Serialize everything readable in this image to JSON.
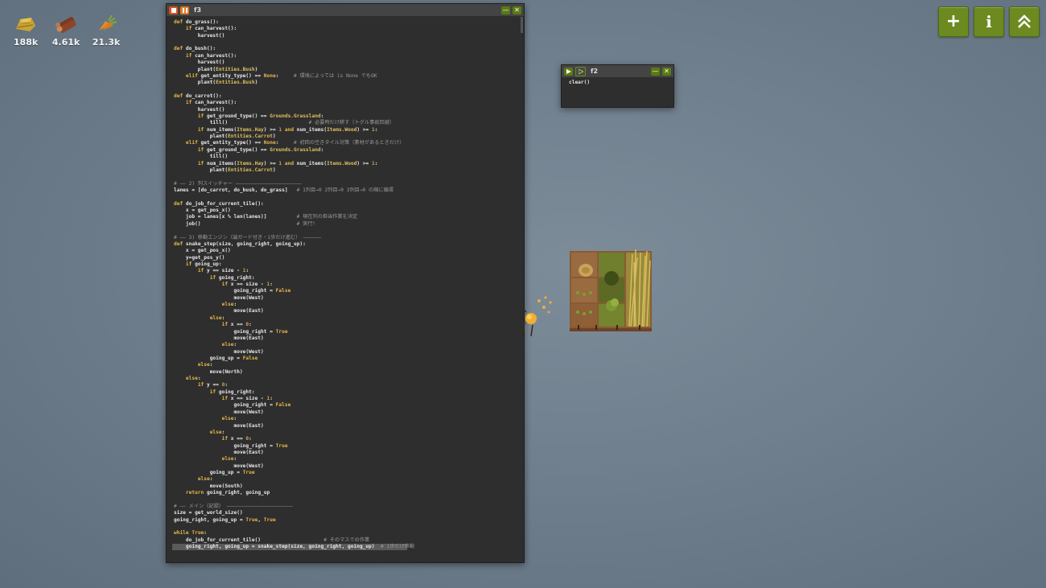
{
  "resources": [
    {
      "name": "hay-icon",
      "count": "188k"
    },
    {
      "name": "wood-icon",
      "count": "4.61k"
    },
    {
      "name": "carrot-icon",
      "count": "21.3k"
    }
  ],
  "top_right_buttons": [
    {
      "name": "add-button",
      "label": "+"
    },
    {
      "name": "info-button",
      "label": "i"
    },
    {
      "name": "upgrade-button",
      "label": "⌃"
    }
  ],
  "editor": {
    "title": "f3",
    "lines": [
      "def do_grass():",
      "    if can_harvest():",
      "        harvest()",
      "",
      "def do_bush():",
      "    if can_harvest():",
      "        harvest()",
      "        plant(Entities.Bush)",
      "    elif get_entity_type() == None:     # 環境によっては is None でもOK",
      "        plant(Entities.Bush)",
      "",
      "def do_carrot():",
      "    if can_harvest():",
      "        harvest()",
      "        if get_ground_type() == Grounds.Grassland:",
      "            till()                           # 必要時だけ耕す（トグル事故回避）",
      "        if num_items(Items.Hay) >= 1 and num_items(Items.Wood) >= 1:",
      "            plant(Entities.Carrot)",
      "    elif get_entity_type() == None:     # 初回の空きタイル対策（素材があるときだけ）",
      "        if get_ground_type() == Grounds.Grassland:",
      "            till()",
      "        if num_items(Items.Hay) >= 1 and num_items(Items.Wood) >= 1:",
      "            plant(Entities.Carrot)",
      "",
      "# —— 2) 列スイッチャー ——————————————————————",
      "lanes = [do_carrot, do_bush, do_grass]   # 1列目→0 2列目→0 3列目→0 の順に循環",
      "",
      "def do_job_for_current_tile():",
      "    x = get_pos_x()",
      "    job = lanes[x % len(lanes)]          # 現在列の担当作業を決定",
      "    job()                                # 実行！",
      "",
      "# —— 3) 移動エンジン（端ガード付き・1歩だけ進む） ——————",
      "def snake_step(size, going_right, going_up):",
      "    x = get_pos_x()",
      "    y=get_pos_y()",
      "    if going_up:",
      "        if y == size - 1:",
      "            if going_right:",
      "                if x == size - 1:",
      "                    going_right = False",
      "                    move(West)",
      "                else:",
      "                    move(East)",
      "            else:",
      "                if x == 0:",
      "                    going_right = True",
      "                    move(East)",
      "                else:",
      "                    move(West)",
      "            going_up = False",
      "        else:",
      "            move(North)",
      "    else:",
      "        if y == 0:",
      "            if going_right:",
      "                if x == size - 1:",
      "                    going_right = False",
      "                    move(West)",
      "                else:",
      "                    move(East)",
      "            else:",
      "                if x == 0:",
      "                    going_right = True",
      "                    move(East)",
      "                else:",
      "                    move(West)",
      "            going_up = True",
      "        else:",
      "            move(South)",
      "    return going_right, going_up",
      "",
      "# —— メイン（記録） ——————————————————————",
      "size = get_world_size()",
      "going_right, going_up = True, True",
      "",
      "while True:",
      "    do_job_for_current_tile()                     # そのマスでの作業",
      "    going_right, going_up = snake_step(size, going_right, going_up)  # 1歩だけ移動"
    ]
  },
  "small_window": {
    "title": "f2",
    "code": "clear()"
  },
  "colors": {
    "accent_green": "#6d8a20",
    "stop_red": "#d9531e",
    "pause_orange": "#e07b2a"
  }
}
